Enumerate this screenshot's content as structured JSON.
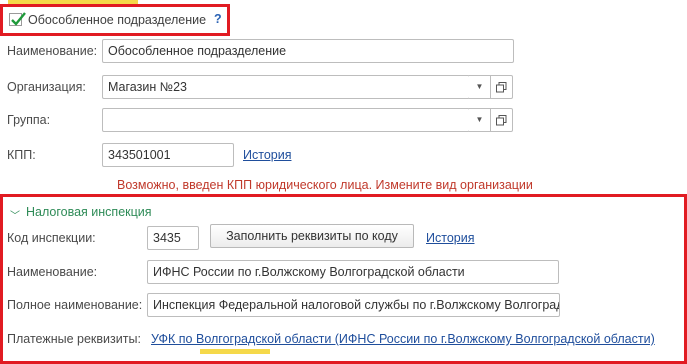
{
  "separate_division": {
    "checkbox_label": "Обособленное подразделение",
    "checked": true,
    "help": "?"
  },
  "form": {
    "name_label": "Наименование:",
    "name_value": "Обособленное подразделение",
    "org_label": "Организация:",
    "org_value": "Магазин №23",
    "group_label": "Группа:",
    "group_value": "",
    "kpp_label": "КПП:",
    "kpp_value": "343501001",
    "history_link": "История",
    "warning": "Возможно, введен КПП юридического лица. Измените вид организации"
  },
  "tax": {
    "section_title": "Налоговая инспекция",
    "code_label": "Код инспекции:",
    "code_value": "3435",
    "fill_button": "Заполнить реквизиты по коду",
    "history_link": "История",
    "name_label": "Наименование:",
    "name_value": "ИФНС России по г.Волжскому Волгоградской области",
    "full_name_label": "Полное наименование:",
    "full_name_value": "Инспекция Федеральной налоговой службы по г.Волжскому Волгоградской области",
    "payment_label": "Платежные реквизиты:",
    "payment_link": "УФК по Волгоградской области (ИФНС России по г.Волжскому Волгоградской области)"
  },
  "colors": {
    "highlight_frame": "#e11b22",
    "link": "#1f4e9c",
    "warning": "#c0392b",
    "section": "#2e8b57"
  }
}
